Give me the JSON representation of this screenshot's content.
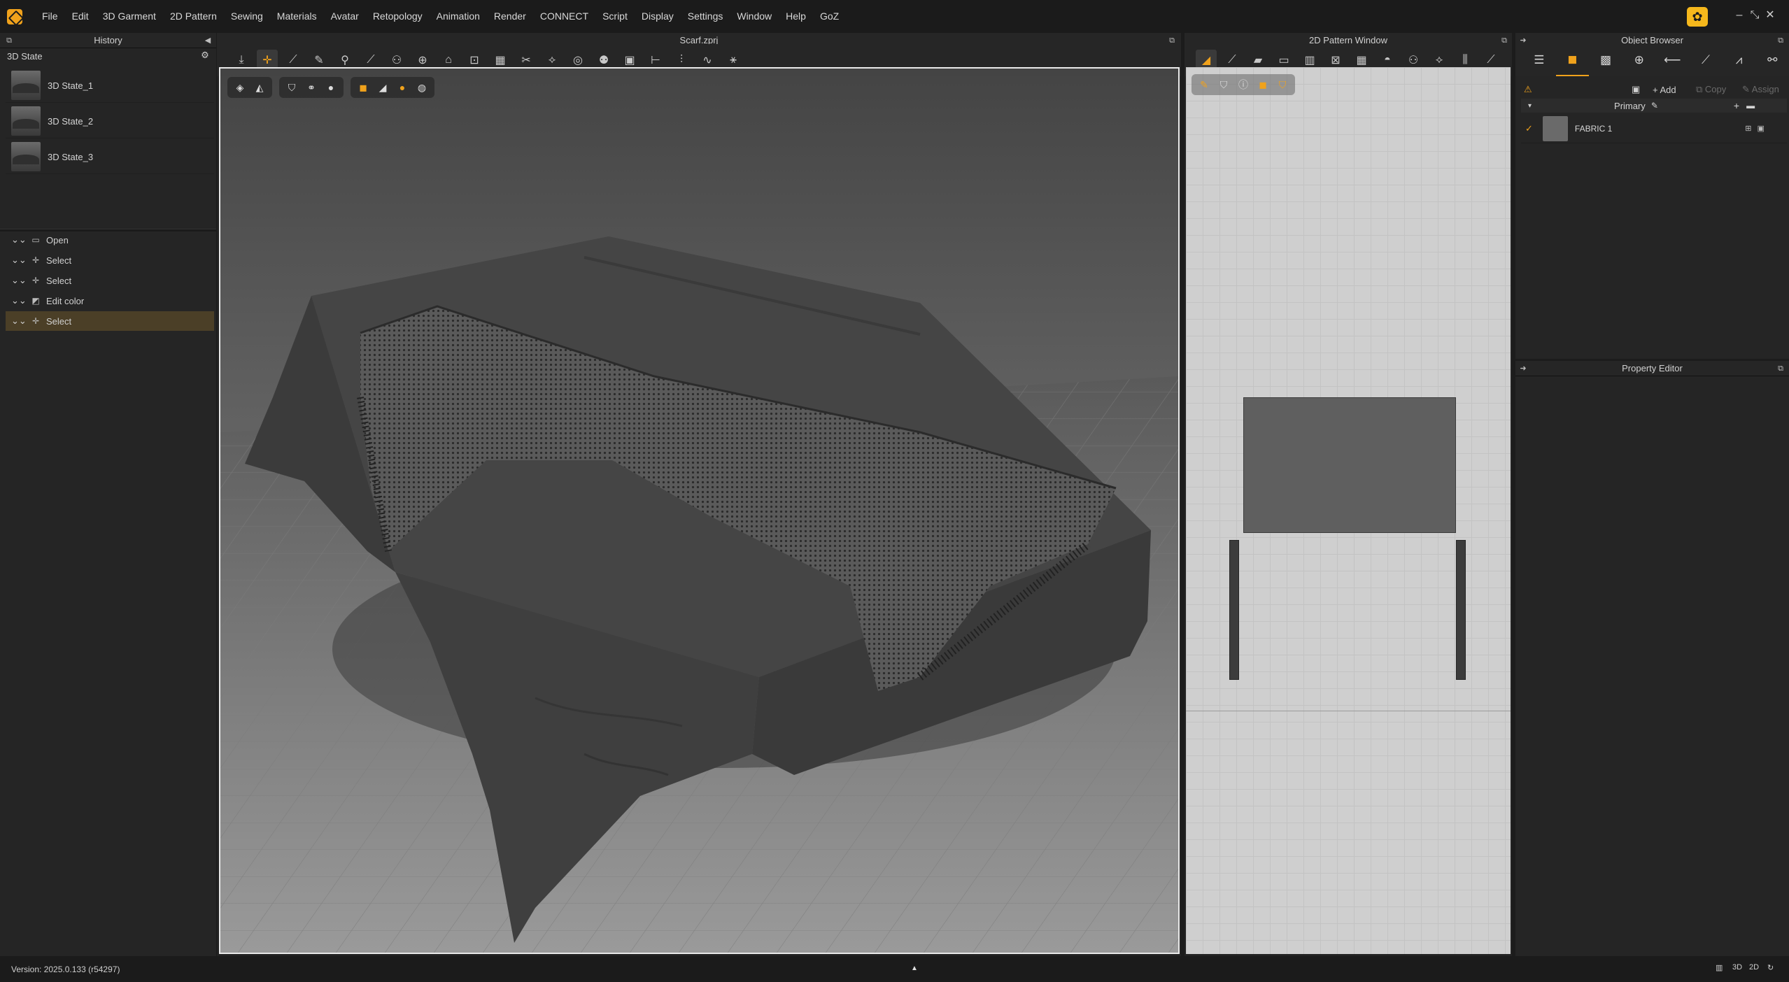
{
  "menu": {
    "items": [
      "File",
      "Edit",
      "3D Garment",
      "2D Pattern",
      "Sewing",
      "Materials",
      "Avatar",
      "Retopology",
      "Animation",
      "Render",
      "CONNECT",
      "Script",
      "Display",
      "Settings",
      "Window",
      "Help",
      "GoZ"
    ]
  },
  "window_controls": {
    "minimize": "–",
    "restore": "⤡",
    "close": "✕"
  },
  "history": {
    "title": "History",
    "state_label": "3D State",
    "states": [
      {
        "name": "3D State_1"
      },
      {
        "name": "3D State_2"
      },
      {
        "name": "3D State_3"
      }
    ],
    "actions": [
      {
        "label": "Open",
        "icon": "folder-icon",
        "selected": false
      },
      {
        "label": "Select",
        "icon": "move-icon",
        "selected": false
      },
      {
        "label": "Select",
        "icon": "move-icon",
        "selected": false
      },
      {
        "label": "Edit color",
        "icon": "edit-color-icon",
        "selected": false
      },
      {
        "label": "Select",
        "icon": "move-icon",
        "selected": true
      }
    ]
  },
  "viewport": {
    "title": "Scarf.zprj"
  },
  "pattern_window": {
    "title": "2D Pattern Window"
  },
  "object_browser": {
    "title": "Object Browser",
    "add_label": "Add",
    "copy_label": "Copy",
    "assign_label": "Assign",
    "group_name": "Primary",
    "fabric_name": "FABRIC 1"
  },
  "property_editor": {
    "title": "Property Editor"
  },
  "status": {
    "version": "Version: 2025.0.133 (r54297)"
  },
  "colors": {
    "accent": "#f0a21c",
    "selected_row": "#4b3f27",
    "panel_bg": "#252525"
  }
}
